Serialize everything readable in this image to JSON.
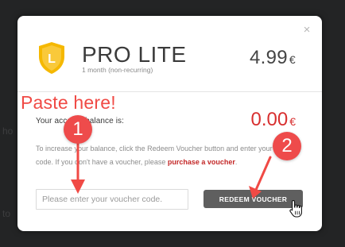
{
  "backdrop": {
    "fragment_1": "ho",
    "fragment_2": "to"
  },
  "modal": {
    "close_glyph": "×",
    "product": {
      "badge_letter": "L",
      "name": "PRO LITE",
      "subtitle": "1 month (non-recurring)",
      "price": "4.99",
      "currency": "€"
    },
    "balance": {
      "label": "Your account balance is:",
      "value": "0.00",
      "currency": "€"
    },
    "info": {
      "text": "To increase your balance, click the Redeem Voucher button and enter your voucher code. If you don't have a voucher, please ",
      "link": "purchase a voucher",
      "suffix": "."
    },
    "voucher": {
      "placeholder": "Please enter your voucher code.",
      "value": ""
    },
    "redeem_label": "REDEEM VOUCHER"
  },
  "annotations": {
    "paste_text": "Paste here!",
    "step_1": "1",
    "step_2": "2",
    "arrow_color": "#f04a45"
  },
  "colors": {
    "accent_red": "#d82f2f",
    "shield_yellow": "#f5b800",
    "button_gray": "#5f5f5f",
    "backdrop": "#232425"
  }
}
